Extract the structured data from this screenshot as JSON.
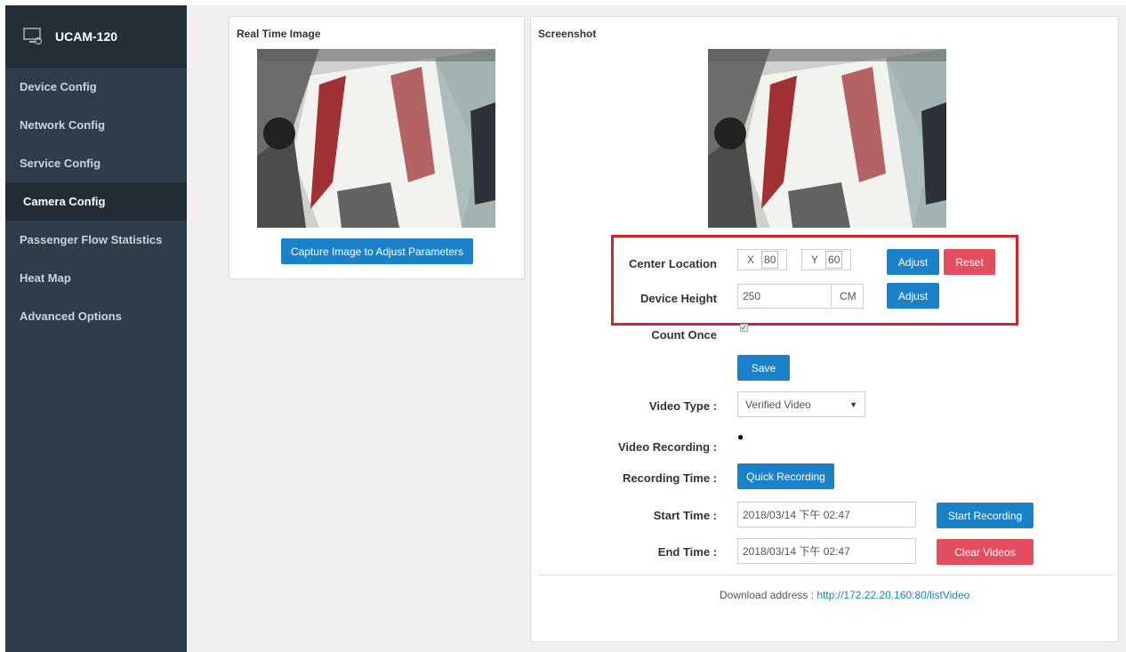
{
  "sidebar": {
    "brand": "UCAM-120",
    "items": [
      {
        "label": "Device Config"
      },
      {
        "label": "Network Config"
      },
      {
        "label": "Service Config"
      },
      {
        "label": "Camera Config"
      },
      {
        "label": "Passenger Flow Statistics"
      },
      {
        "label": "Heat Map"
      },
      {
        "label": "Advanced Options"
      }
    ],
    "active_index": 3
  },
  "realtime": {
    "title": "Real Time Image",
    "capture_button": "Capture Image to Adjust Parameters"
  },
  "screenshot": {
    "title": "Screenshot",
    "center_location": {
      "label": "Center Location",
      "x_label": "X",
      "x_value": "80",
      "y_label": "Y",
      "y_value": "60",
      "adjust": "Adjust",
      "reset": "Reset"
    },
    "device_height": {
      "label": "Device Height",
      "value": "250",
      "unit": "CM",
      "adjust": "Adjust"
    },
    "count_once": {
      "label": "Count Once",
      "checked": true
    },
    "save": "Save",
    "video_type": {
      "label": "Video Type :",
      "selected": "Verified Video"
    },
    "video_recording": {
      "label": "Video Recording :",
      "indicator": "●"
    },
    "recording_time": {
      "label": "Recording Time :",
      "button": "Quick Recording"
    },
    "start_time": {
      "label": "Start Time :",
      "value": "2018/03/14 下午 02:47",
      "button": "Start Recording"
    },
    "end_time": {
      "label": "End Time :",
      "value": "2018/03/14 下午 02:47",
      "button": "Clear Videos"
    },
    "download": {
      "label": "Download address :",
      "url": "http://172.22.20.160:80/listVideo"
    }
  },
  "colors": {
    "sidebar_bg": "#2f3d4a",
    "accent_blue": "#1b82c9",
    "danger_red": "#e44d5f",
    "highlight_red": "#d2232a"
  }
}
